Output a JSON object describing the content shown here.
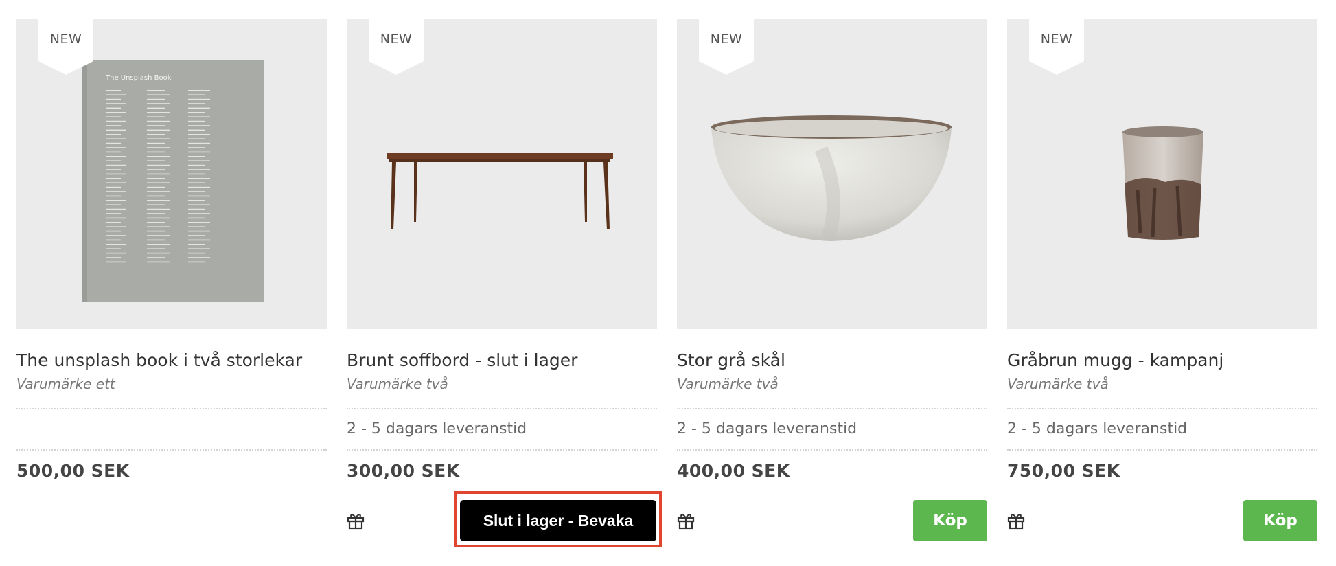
{
  "products": [
    {
      "badge": "NEW",
      "image_label": "book-image",
      "book_title": "The Unsplash Book",
      "title": "The unsplash book i två storlekar",
      "brand": "Varumärke ett",
      "delivery": "",
      "price": "500,00 SEK",
      "action": null
    },
    {
      "badge": "NEW",
      "image_label": "coffee-table-image",
      "title": "Brunt soffbord - slut i lager",
      "brand": "Varumärke två",
      "delivery": "2 - 5 dagars leveranstid",
      "price": "300,00 SEK",
      "action": "Slut i lager - Bevaka"
    },
    {
      "badge": "NEW",
      "image_label": "bowl-image",
      "title": "Stor grå skål",
      "brand": "Varumärke två",
      "delivery": "2 - 5 dagars leveranstid",
      "price": "400,00 SEK",
      "action": "Köp"
    },
    {
      "badge": "NEW",
      "image_label": "mug-image",
      "title": "Gråbrun mugg - kampanj",
      "brand": "Varumärke två",
      "delivery": "2 - 5 dagars leveranstid",
      "price": "750,00 SEK",
      "action": "Köp"
    }
  ],
  "colors": {
    "buy": "#5cb84e",
    "notify": "#000000",
    "highlight": "#e0452f",
    "image_bg": "#ebebeb"
  },
  "icons": {
    "gift": "gift-icon"
  }
}
